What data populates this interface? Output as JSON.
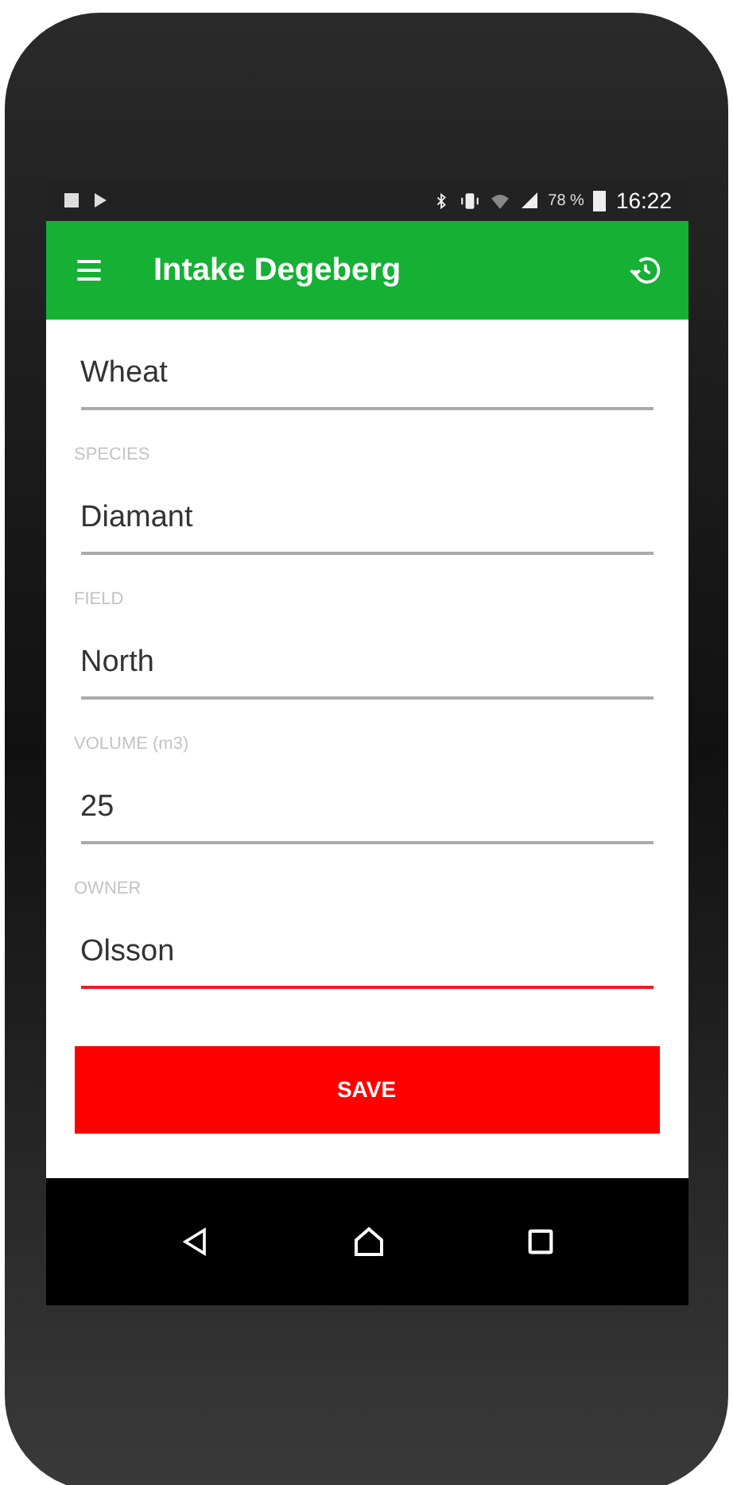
{
  "status_bar": {
    "battery": "78 %",
    "time": "16:22"
  },
  "app_bar": {
    "title": "Intake Degeberg"
  },
  "fields": [
    {
      "value": "Wheat",
      "focused": false
    },
    {
      "label": "SPECIES",
      "value": "Diamant",
      "focused": false
    },
    {
      "label": "FIELD",
      "value": "North",
      "focused": false
    },
    {
      "label": "VOLUME (m3)",
      "value": "25",
      "focused": false
    },
    {
      "label": "OWNER",
      "value": "Olsson",
      "focused": true
    }
  ],
  "save_button": {
    "label": "SAVE"
  }
}
